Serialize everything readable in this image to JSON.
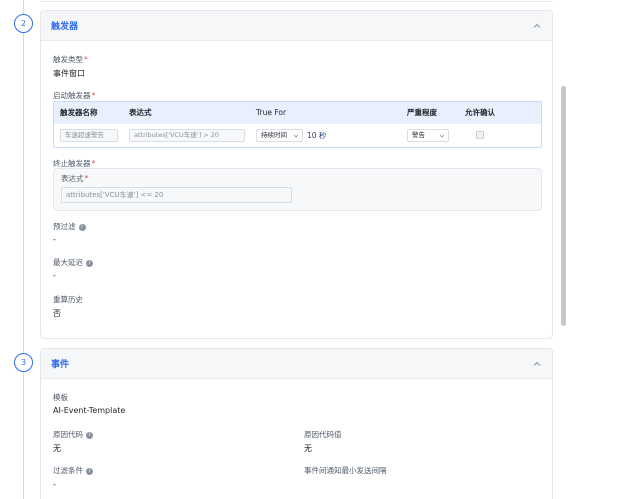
{
  "steps": [
    {
      "number": "2",
      "title": "触发器"
    },
    {
      "number": "3",
      "title": "事件"
    }
  ],
  "trigger": {
    "type_label": "触发类型",
    "type_value": "事件窗口",
    "start_label": "启动触发器",
    "table": {
      "headers": [
        "触发器名称",
        "表达式",
        "True For",
        "严重程度",
        "允许确认"
      ],
      "row": {
        "name": "车速超速警告",
        "expression": "attributes['VCU车速'] > 20",
        "duration_type": "持续时间",
        "duration_value": "10 秒",
        "severity": "警告"
      }
    },
    "stop_label": "终止触发器",
    "stop_expression_label": "表达式",
    "stop_expression": "attributes['VCU车速'] <= 20",
    "prefilter_label": "预过滤",
    "prefilter_value": "-",
    "max_delay_label": "最大延迟",
    "max_delay_value": "-",
    "recalc_label": "重算历史",
    "recalc_value": "否"
  },
  "event": {
    "template_label": "模板",
    "template_value": "AI-Event-Template",
    "reason_code_label": "原因代码",
    "reason_code_value": "无",
    "reason_code_val_label": "原因代码值",
    "reason_code_val_value": "无",
    "filter_label": "过滤条件",
    "filter_value": "-",
    "min_interval_label": "事件间通知最小发送间隔"
  },
  "colors": {
    "accent": "#2f6bef",
    "required": "#e5484d"
  }
}
